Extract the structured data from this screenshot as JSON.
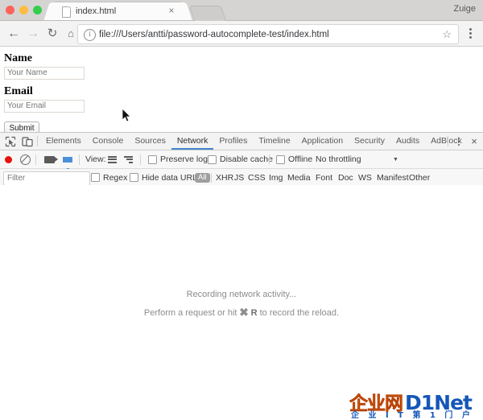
{
  "browser": {
    "window_controls": [
      "close",
      "minimize",
      "maximize"
    ],
    "tab": {
      "title": "index.html",
      "close_label": "×",
      "favicon": "document-icon"
    },
    "new_tab_label": "",
    "profile_name": "Zuige",
    "nav": {
      "back": "←",
      "forward": "→",
      "reload": "↻",
      "home": "⌂"
    },
    "omnibox": {
      "info_icon": "i",
      "url": "file:///Users/antti/password-autocomplete-test/index.html",
      "star": "☆"
    },
    "menu_icon": "kebab-menu-icon"
  },
  "page": {
    "fields": [
      {
        "label": "Name",
        "placeholder": "Your Name",
        "value": ""
      },
      {
        "label": "Email",
        "placeholder": "Your Email",
        "value": ""
      }
    ],
    "submit_label": "Submit"
  },
  "devtools": {
    "tabs": [
      {
        "label": "Elements",
        "active": false
      },
      {
        "label": "Console",
        "active": false
      },
      {
        "label": "Sources",
        "active": false
      },
      {
        "label": "Network",
        "active": true
      },
      {
        "label": "Profiles",
        "active": false
      },
      {
        "label": "Timeline",
        "active": false
      },
      {
        "label": "Application",
        "active": false
      },
      {
        "label": "Security",
        "active": false
      },
      {
        "label": "Audits",
        "active": false
      },
      {
        "label": "AdBlock",
        "active": false
      }
    ],
    "close_label": "×",
    "toolbar": {
      "record_tooltip": "record-button",
      "clear_tooltip": "clear-button",
      "camera_tooltip": "capture-screenshots-button",
      "filter_tooltip": "filter-button",
      "view_label": "View:",
      "preserve_log_label": "Preserve log",
      "preserve_log_checked": false,
      "disable_cache_label": "Disable cache",
      "disable_cache_checked": false,
      "offline_label": "Offline",
      "offline_checked": false,
      "throttling_value": "No throttling",
      "throttling_arrow": "▼"
    },
    "filterbar": {
      "filter_placeholder": "Filter",
      "filter_value": "",
      "regex_label": "Regex",
      "regex_checked": false,
      "hide_data_urls_label": "Hide data URLs",
      "hide_data_urls_checked": false,
      "types": [
        "All",
        "XHR",
        "JS",
        "CSS",
        "Img",
        "Media",
        "Font",
        "Doc",
        "WS",
        "Manifest",
        "Other"
      ],
      "active_type": "All"
    },
    "empty_state": {
      "line1": "Recording network activity...",
      "line2_before": "Perform a request or hit ",
      "line2_key1": "⌘",
      "line2_key2": "R",
      "line2_after": " to record the reload."
    }
  },
  "watermark": {
    "cn_text": "企业网",
    "brand_text": "D1Net",
    "subtitle": "企 业  I T  第 1 门 户",
    "orange": "#f07c12",
    "blue": "#1457b8"
  }
}
